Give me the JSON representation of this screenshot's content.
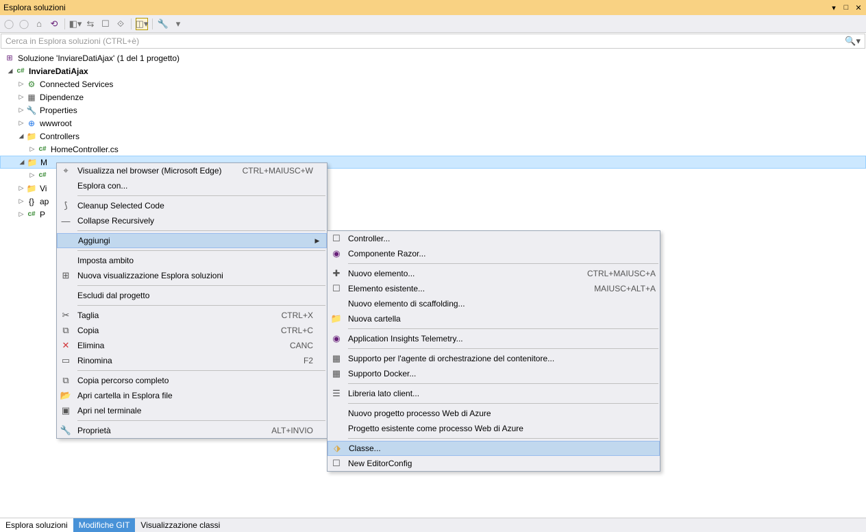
{
  "titlebar": {
    "title": "Esplora soluzioni"
  },
  "search": {
    "placeholder": "Cerca in Esplora soluzioni (CTRL+è)"
  },
  "tree": {
    "solution": "Soluzione 'InviareDatiAjax' (1 del 1 progetto)",
    "project": "InviareDatiAjax",
    "nodes": {
      "connected": "Connected Services",
      "deps": "Dipendenze",
      "props": "Properties",
      "wwwroot": "wwwroot",
      "controllers": "Controllers",
      "homecontroller": "HomeController.cs",
      "models": "M",
      "views": "Vi",
      "appsettings": "ap",
      "program": "P"
    }
  },
  "ctx1": {
    "browser": "Visualizza nel browser (Microsoft Edge)",
    "browser_sc": "CTRL+MAIUSC+W",
    "explore": "Esplora con...",
    "cleanup": "Cleanup Selected Code",
    "collapse": "Collapse Recursively",
    "add": "Aggiungi",
    "scope": "Imposta ambito",
    "newview": "Nuova visualizzazione Esplora soluzioni",
    "exclude": "Escludi dal progetto",
    "cut": "Taglia",
    "cut_sc": "CTRL+X",
    "copy": "Copia",
    "copy_sc": "CTRL+C",
    "delete": "Elimina",
    "delete_sc": "CANC",
    "rename": "Rinomina",
    "rename_sc": "F2",
    "copypath": "Copia percorso completo",
    "openfolder": "Apri cartella in Esplora file",
    "terminal": "Apri nel terminale",
    "properties": "Proprietà",
    "properties_sc": "ALT+INVIO"
  },
  "ctx2": {
    "controller": "Controller...",
    "razor": "Componente Razor...",
    "newitem": "Nuovo elemento...",
    "newitem_sc": "CTRL+MAIUSC+A",
    "existitem": "Elemento esistente...",
    "existitem_sc": "MAIUSC+ALT+A",
    "scaffold": "Nuovo elemento di scaffolding...",
    "newfolder": "Nuova cartella",
    "insights": "Application Insights Telemetry...",
    "orchestr": "Supporto per l'agente di orchestrazione del contenitore...",
    "docker": "Supporto Docker...",
    "clientlib": "Libreria lato client...",
    "azurenew": "Nuovo progetto processo Web di Azure",
    "azureexist": "Progetto esistente come processo Web di Azure",
    "class": "Classe...",
    "editorconfig": "New EditorConfig"
  },
  "status": {
    "t1": "Esplora soluzioni",
    "t2": "Modifiche GIT",
    "t3": "Visualizzazione classi"
  }
}
